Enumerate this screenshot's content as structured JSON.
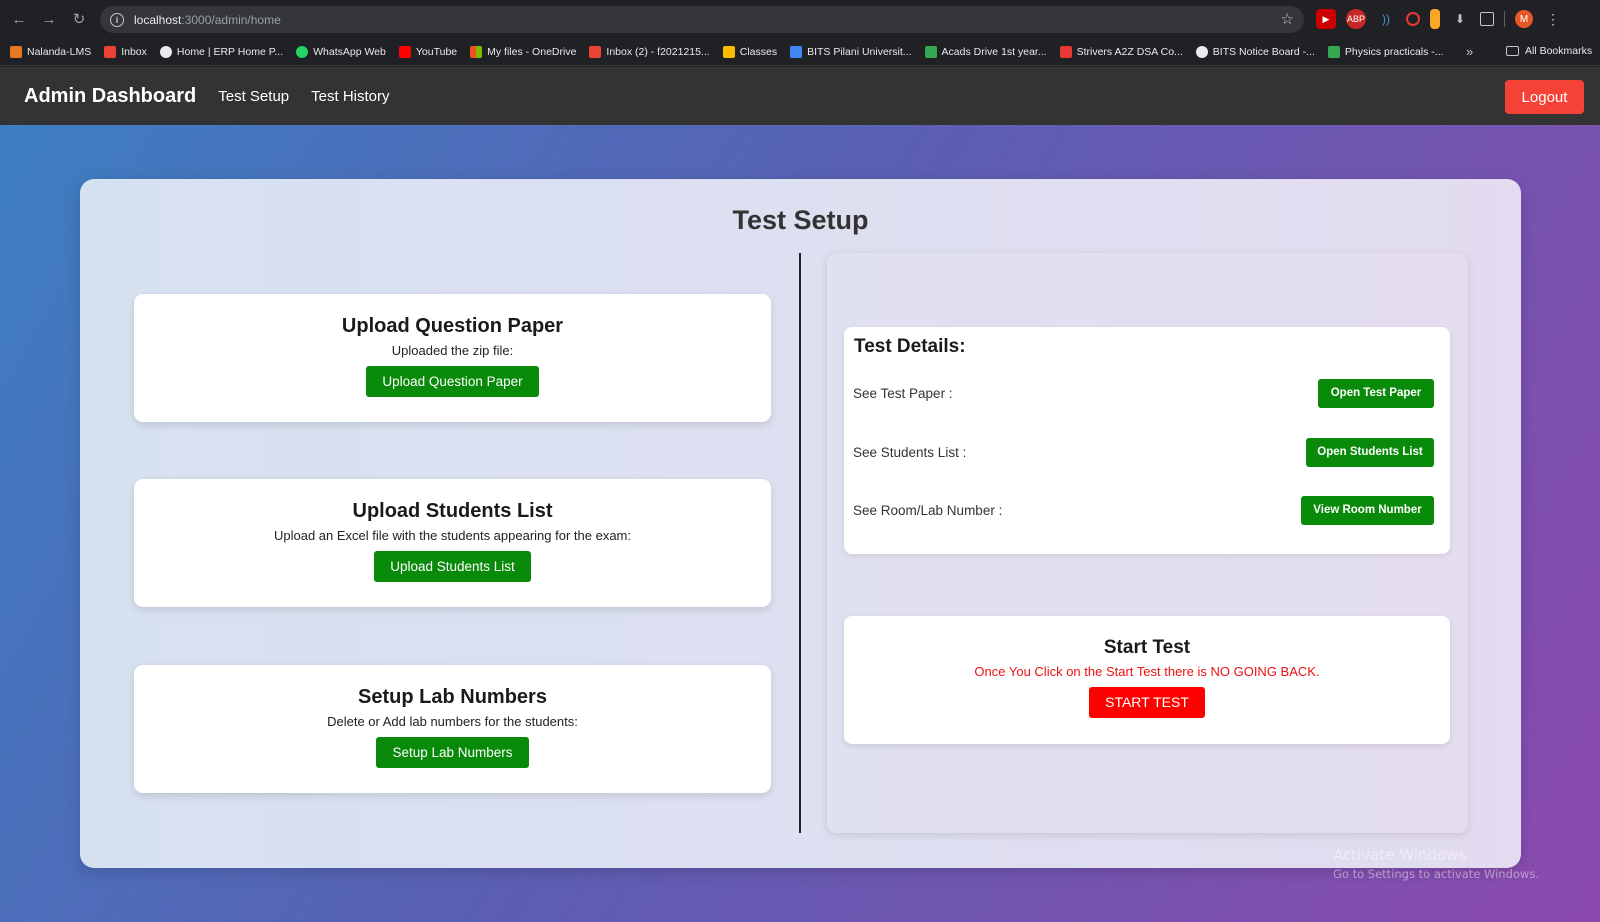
{
  "browser": {
    "url_host": "localhost",
    "url_path": ":3000/admin/home",
    "profile_initial": "M",
    "bookmarks": [
      {
        "label": "Nalanda-LMS",
        "color": "#e87722"
      },
      {
        "label": "Inbox",
        "color": "#ea4335"
      },
      {
        "label": "Home | ERP Home P...",
        "color": "#e8eaed"
      },
      {
        "label": "WhatsApp Web",
        "color": "#25d366"
      },
      {
        "label": "YouTube",
        "color": "#ff0000"
      },
      {
        "label": "My files - OneDrive",
        "color": "#f25022"
      },
      {
        "label": "Inbox (2) - f2021215...",
        "color": "#ea4335"
      },
      {
        "label": "Classes",
        "color": "#fbbc04"
      },
      {
        "label": "BITS Pilani Universit...",
        "color": "#4285f4"
      },
      {
        "label": "Acads Drive 1st year...",
        "color": "#34a853"
      },
      {
        "label": "Strivers A2Z DSA Co...",
        "color": "#e53935"
      },
      {
        "label": "BITS Notice Board -...",
        "color": "#e8eaed"
      },
      {
        "label": "Physics practicals -...",
        "color": "#34a853"
      }
    ],
    "all_bookmarks": "All Bookmarks"
  },
  "navbar": {
    "brand": "Admin Dashboard",
    "links": [
      "Test Setup",
      "Test History"
    ],
    "logout": "Logout"
  },
  "page": {
    "title": "Test Setup",
    "cards": [
      {
        "title": "Upload Question Paper",
        "desc": "Uploaded the zip file:",
        "button": "Upload Question Paper"
      },
      {
        "title": "Upload Students List",
        "desc": "Upload an Excel file with the students appearing for the exam:",
        "button": "Upload Students List"
      },
      {
        "title": "Setup Lab Numbers",
        "desc": "Delete or Add lab numbers for the students:",
        "button": "Setup Lab Numbers"
      }
    ],
    "details": {
      "title": "Test Details:",
      "rows": [
        {
          "label": "See Test Paper :",
          "button": "Open Test Paper"
        },
        {
          "label": "See Students List :",
          "button": "Open Students List"
        },
        {
          "label": "See Room/Lab Number :",
          "button": "View Room Number"
        }
      ]
    },
    "start": {
      "title": "Start Test",
      "warning": "Once You Click on the Start Test there is NO GOING BACK.",
      "button": "START TEST"
    }
  },
  "watermark": {
    "line1": "Activate Windows",
    "line2": "Go to Settings to activate Windows."
  },
  "colors": {
    "green_button": "#0a8a0a",
    "logout_red": "#f44336",
    "start_red": "#ff0000"
  }
}
